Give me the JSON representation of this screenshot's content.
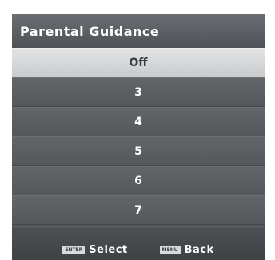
{
  "menu": {
    "title": "Parental Guidance",
    "items": [
      {
        "label": "Off",
        "selected": true
      },
      {
        "label": "3",
        "selected": false
      },
      {
        "label": "4",
        "selected": false
      },
      {
        "label": "5",
        "selected": false
      },
      {
        "label": "6",
        "selected": false
      },
      {
        "label": "7",
        "selected": false
      }
    ]
  },
  "footer": {
    "enter_key": "ENTER",
    "select_label": "Select",
    "menu_key": "MENU",
    "back_label": "Back"
  },
  "colors": {
    "panel": "#56595d",
    "selected_row": "#d6d7d8",
    "text": "#ffffff"
  }
}
